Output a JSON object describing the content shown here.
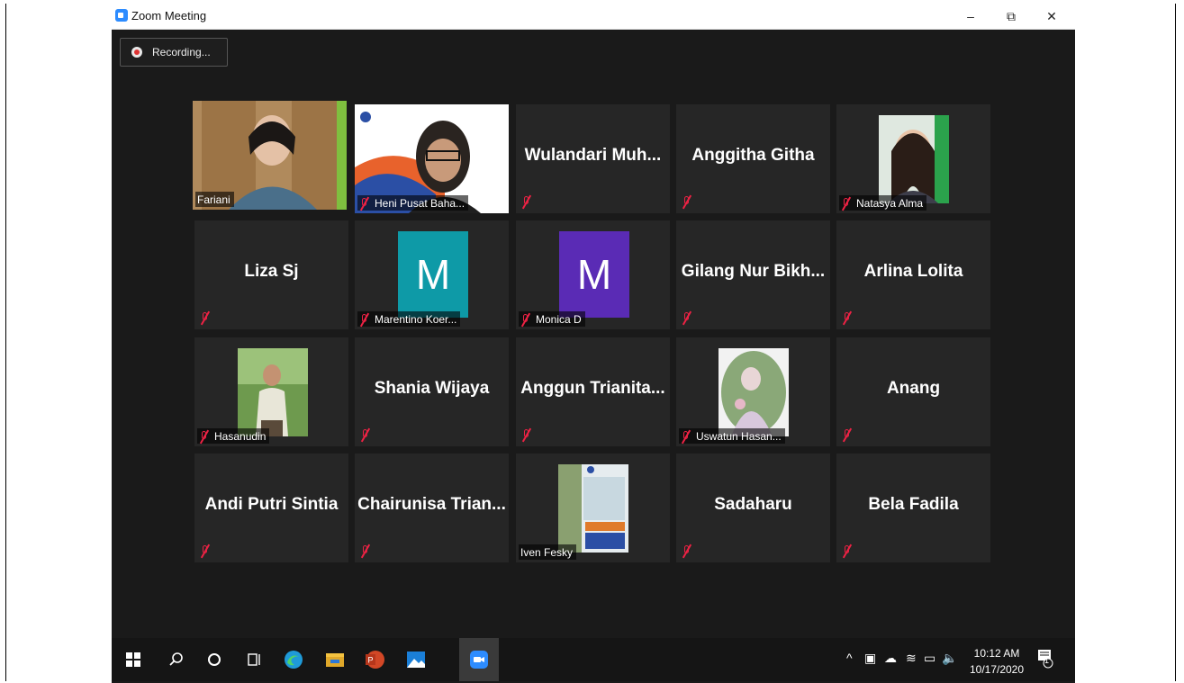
{
  "window": {
    "title": "Zoom Meeting",
    "controls": {
      "minimize": "–",
      "maximize": "⧉",
      "close": "✕"
    }
  },
  "recording": {
    "label": "Recording..."
  },
  "participants": [
    {
      "name": "Fariani",
      "type": "video",
      "muted": false,
      "active_speaker": true
    },
    {
      "name": "Heni Pusat Baha...",
      "type": "video",
      "muted": true
    },
    {
      "name": "Wulandari  Muh...",
      "type": "name",
      "muted": true
    },
    {
      "name": "Anggitha Githa",
      "type": "name",
      "muted": true
    },
    {
      "name": "Natasya Alma",
      "type": "photo",
      "muted": true
    },
    {
      "name": "Liza Sj",
      "type": "name",
      "muted": true
    },
    {
      "name": "Marentino Koer...",
      "type": "avatar",
      "initial": "M",
      "color": "#0e9aa7",
      "muted": true
    },
    {
      "name": "Monica D",
      "type": "avatar",
      "initial": "M",
      "color": "#5a2bb5",
      "muted": true
    },
    {
      "name": "Gilang  Nur  Bikh...",
      "type": "name",
      "muted": true
    },
    {
      "name": "Arlina Lolita",
      "type": "name",
      "muted": true
    },
    {
      "name": "Hasanudin",
      "type": "photo",
      "muted": true
    },
    {
      "name": "Shania Wijaya",
      "type": "name",
      "muted": true
    },
    {
      "name": "Anggun  Trianita...",
      "type": "name",
      "muted": true
    },
    {
      "name": "Uswatun Hasan...",
      "type": "photo",
      "muted": true
    },
    {
      "name": "Anang",
      "type": "name",
      "muted": true
    },
    {
      "name": "Andi Putri Sintia",
      "type": "name",
      "muted": true
    },
    {
      "name": "Chairunisa  Trian...",
      "type": "name",
      "muted": true
    },
    {
      "name": "Iven Fesky",
      "type": "photo",
      "muted": false
    },
    {
      "name": "Sadaharu",
      "type": "name",
      "muted": true
    },
    {
      "name": "Bela Fadila",
      "type": "name",
      "muted": true
    }
  ],
  "taskbar": {
    "items": [
      "windows-start",
      "search",
      "cortana",
      "task-view",
      "edge",
      "file-explorer",
      "powerpoint",
      "photos",
      "zoom"
    ],
    "clock": {
      "time": "10:12 AM",
      "date": "10/17/2020"
    },
    "notification_count": "1"
  },
  "colors": {
    "background": "#1a1a1a",
    "tile": "#262626",
    "active_border": "#d8e85a",
    "mute_icon": "#e22244"
  }
}
